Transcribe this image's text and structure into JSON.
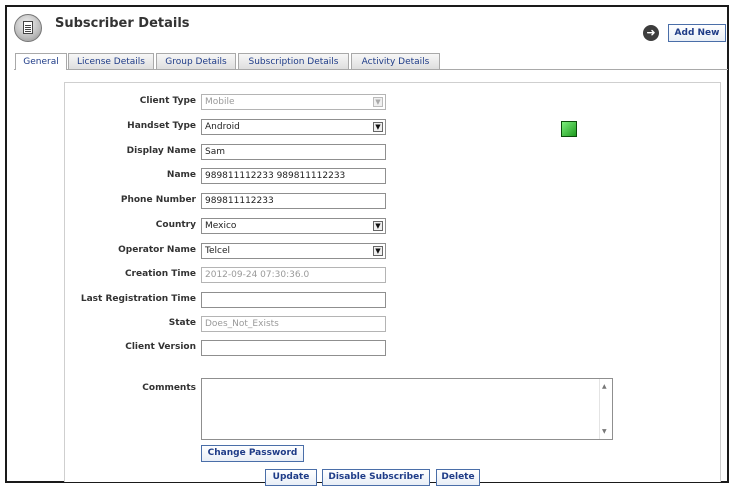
{
  "header": {
    "title": "Subscriber Details",
    "add_new_label": "Add New",
    "nav_icon": "circle-arrow-icon",
    "app_icon": "document-icon"
  },
  "tabs": [
    {
      "label": "General",
      "active": true
    },
    {
      "label": "License Details",
      "active": false
    },
    {
      "label": "Group Details",
      "active": false
    },
    {
      "label": "Subscription Details",
      "active": false
    },
    {
      "label": "Activity Details",
      "active": false
    }
  ],
  "form": {
    "client_type": {
      "label": "Client Type",
      "value": "Mobile"
    },
    "handset_type": {
      "label": "Handset Type",
      "value": "Android"
    },
    "display_name": {
      "label": "Display Name",
      "value": "Sam"
    },
    "name": {
      "label": "Name",
      "value": "989811112233 989811112233"
    },
    "phone_number": {
      "label": "Phone Number",
      "value": "989811112233"
    },
    "country": {
      "label": "Country",
      "value": "Mexico"
    },
    "operator_name": {
      "label": "Operator Name",
      "value": "Telcel"
    },
    "creation_time": {
      "label": "Creation Time",
      "value": "2012-09-24 07:30:36.0"
    },
    "last_registration_time": {
      "label": "Last Registration Time",
      "value": ""
    },
    "state": {
      "label": "State",
      "value": "Does_Not_Exists"
    },
    "client_version": {
      "label": "Client Version",
      "value": ""
    },
    "comments": {
      "label": "Comments",
      "value": ""
    }
  },
  "status_color": "#2fbf2f",
  "actions": {
    "change_password": "Change Password",
    "update": "Update",
    "disable_subscriber": "Disable Subscriber",
    "delete": "Delete"
  }
}
